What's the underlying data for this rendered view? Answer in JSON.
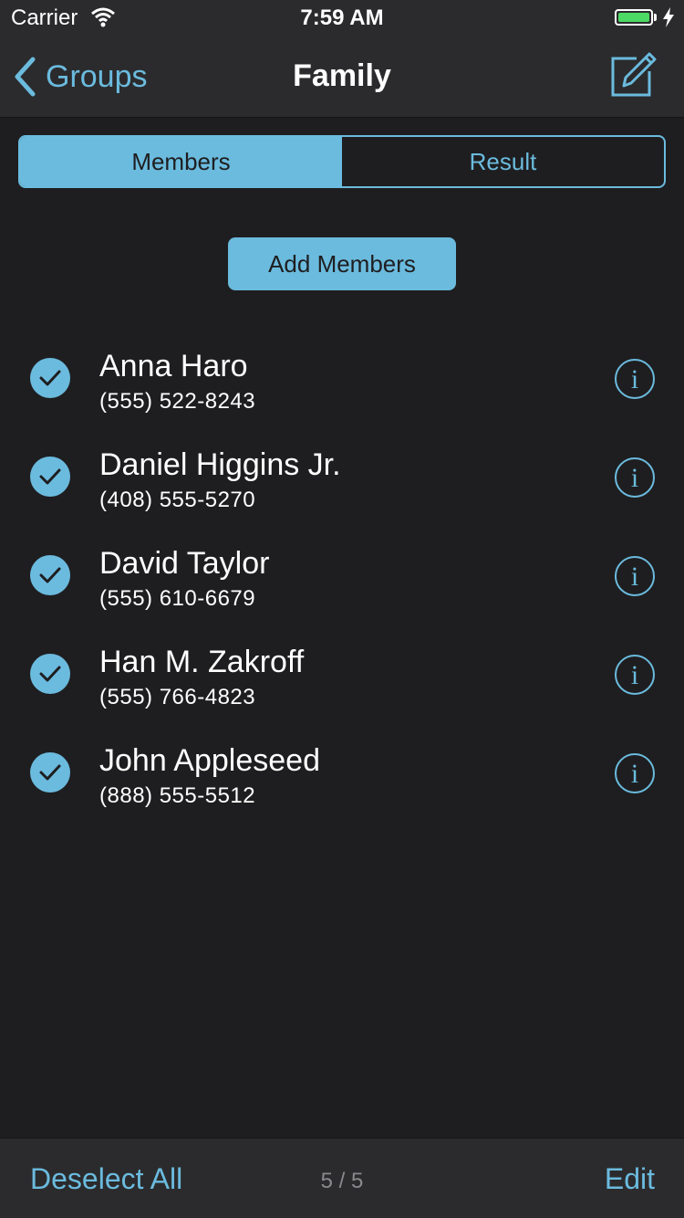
{
  "status_bar": {
    "carrier": "Carrier",
    "time": "7:59 AM",
    "battery_level": 1.0,
    "battery_color": "#4cd964"
  },
  "nav": {
    "back_label": "Groups",
    "title": "Family",
    "compose_icon": "compose-icon"
  },
  "segments": [
    {
      "label": "Members",
      "selected": true
    },
    {
      "label": "Result",
      "selected": false
    }
  ],
  "add_members_label": "Add Members",
  "contacts": [
    {
      "name": "Anna Haro",
      "phone": "(555) 522-8243",
      "checked": true
    },
    {
      "name": "Daniel Higgins Jr.",
      "phone": "(408) 555-5270",
      "checked": true
    },
    {
      "name": "David Taylor",
      "phone": "(555) 610-6679",
      "checked": true
    },
    {
      "name": "Han M. Zakroff",
      "phone": "(555) 766-4823",
      "checked": true
    },
    {
      "name": "John Appleseed",
      "phone": "(888) 555-5512",
      "checked": true
    }
  ],
  "toolbar": {
    "deselect_label": "Deselect All",
    "count": "5 / 5",
    "edit_label": "Edit"
  },
  "colors": {
    "accent": "#6bbbde",
    "background": "#1e1e20",
    "bar": "#2b2b2d"
  }
}
